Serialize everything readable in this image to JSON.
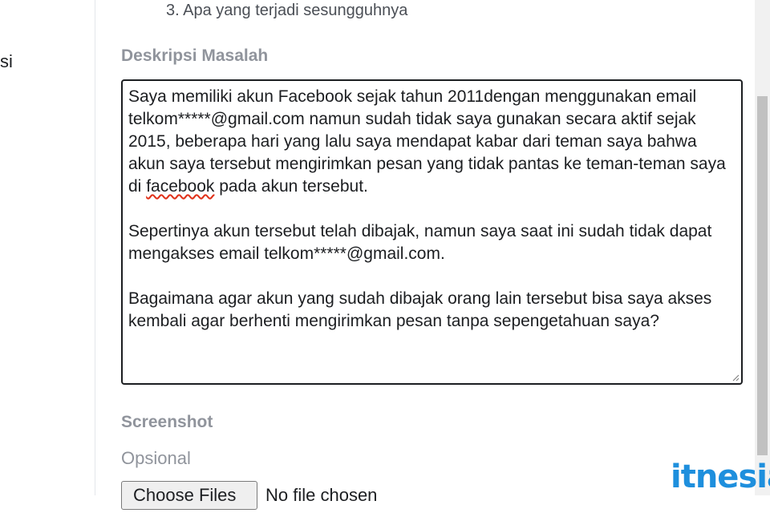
{
  "left_panel": {
    "fragment": "si"
  },
  "steps": {
    "item3": "3. Apa yang terjadi sesungguhnya"
  },
  "description": {
    "title": "Deskripsi Masalah",
    "para1_before": "Saya memiliki akun Facebook sejak tahun 2011dengan menggunakan email telkom*****@gmail.com namun sudah tidak saya gunakan secara aktif sejak 2015, beberapa hari yang lalu saya mendapat kabar dari teman saya bahwa akun saya tersebut mengirimkan pesan yang tidak pantas ke teman-teman saya di ",
    "para1_misspelled": "facebook",
    "para1_after": " pada akun tersebut.",
    "para2": "Sepertinya akun tersebut telah dibajak, namun saya saat ini sudah tidak dapat mengakses email telkom*****@gmail.com.",
    "para3": "Bagaimana agar akun yang sudah dibajak orang lain tersebut bisa saya akses kembali agar berhenti mengirimkan pesan tanpa sepengetahuan saya?"
  },
  "screenshot": {
    "title": "Screenshot",
    "optional_label": "Opsional",
    "choose_button": "Choose Files",
    "no_file": "No file chosen"
  },
  "watermark": "itnesia",
  "colors": {
    "heading": "#90949c",
    "text": "#1c1e21",
    "watermark": "#1e8fdd",
    "spell_underline": "#e0321a"
  }
}
